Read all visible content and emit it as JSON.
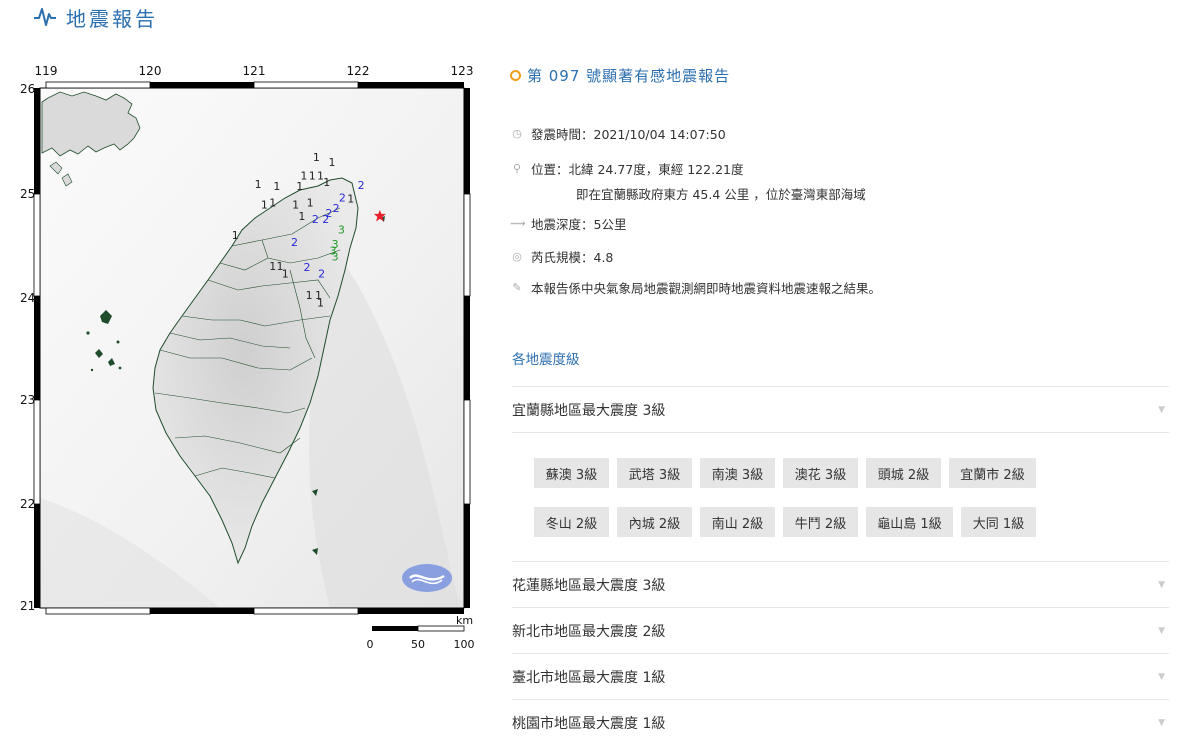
{
  "header": {
    "title": "地震報告",
    "icon": "seismograph-icon"
  },
  "map": {
    "lon_ticks": [
      "119",
      "120",
      "121",
      "122",
      "123"
    ],
    "lat_ticks": [
      "26",
      "25",
      "24",
      "23",
      "22",
      "21"
    ],
    "scale_unit": "km",
    "scale_labels": [
      "0",
      "50",
      "100"
    ],
    "epicenter": {
      "lon": 122.21,
      "lat": 24.77,
      "color": "#e8202a"
    },
    "intensity_colors": {
      "1": "#222222",
      "2": "#2a2ad8",
      "3": "#1f9a2a"
    },
    "intensity_marks": [
      {
        "v": "1",
        "lon": 121.6,
        "lat": 25.3
      },
      {
        "v": "1",
        "lon": 121.75,
        "lat": 25.25
      },
      {
        "v": "1",
        "lon": 121.48,
        "lat": 25.12
      },
      {
        "v": "1",
        "lon": 121.56,
        "lat": 25.12
      },
      {
        "v": "1",
        "lon": 121.64,
        "lat": 25.12
      },
      {
        "v": "1",
        "lon": 121.7,
        "lat": 25.06
      },
      {
        "v": "1",
        "lon": 121.04,
        "lat": 25.04
      },
      {
        "v": "1",
        "lon": 121.22,
        "lat": 25.02
      },
      {
        "v": "1",
        "lon": 121.44,
        "lat": 25.02
      },
      {
        "v": "1",
        "lon": 121.1,
        "lat": 24.84
      },
      {
        "v": "1",
        "lon": 121.18,
        "lat": 24.86
      },
      {
        "v": "1",
        "lon": 121.4,
        "lat": 24.84
      },
      {
        "v": "1",
        "lon": 121.54,
        "lat": 24.86
      },
      {
        "v": "1",
        "lon": 121.46,
        "lat": 24.73
      },
      {
        "v": "1",
        "lon": 121.93,
        "lat": 24.9
      },
      {
        "v": "1",
        "lon": 120.82,
        "lat": 24.55
      },
      {
        "v": "1",
        "lon": 121.18,
        "lat": 24.25
      },
      {
        "v": "1",
        "lon": 121.25,
        "lat": 24.25
      },
      {
        "v": "1",
        "lon": 121.3,
        "lat": 24.18
      },
      {
        "v": "1",
        "lon": 121.53,
        "lat": 23.97
      },
      {
        "v": "1",
        "lon": 121.62,
        "lat": 23.97
      },
      {
        "v": "1",
        "lon": 121.64,
        "lat": 23.9
      },
      {
        "v": "2",
        "lon": 122.03,
        "lat": 25.03
      },
      {
        "v": "2",
        "lon": 121.85,
        "lat": 24.91
      },
      {
        "v": "2",
        "lon": 121.79,
        "lat": 24.81
      },
      {
        "v": "2",
        "lon": 121.72,
        "lat": 24.76
      },
      {
        "v": "2",
        "lon": 121.59,
        "lat": 24.7
      },
      {
        "v": "2",
        "lon": 121.69,
        "lat": 24.7
      },
      {
        "v": "2",
        "lon": 121.39,
        "lat": 24.48
      },
      {
        "v": "2",
        "lon": 121.51,
        "lat": 24.24
      },
      {
        "v": "2",
        "lon": 121.65,
        "lat": 24.18
      },
      {
        "v": "3",
        "lon": 121.84,
        "lat": 24.6
      },
      {
        "v": "3",
        "lon": 121.78,
        "lat": 24.46
      },
      {
        "v": "3",
        "lon": 121.76,
        "lat": 24.4
      },
      {
        "v": "3",
        "lon": 121.78,
        "lat": 24.34
      }
    ],
    "logo": "cwb-logo"
  },
  "report": {
    "title": "第 097 號顯著有感地震報告",
    "time_label": "發震時間：2021/10/04 14:07:50",
    "location_label": "位置：北緯 24.77度，東經 122.21度",
    "location_detail": "即在宜蘭縣政府東方 45.4 公里 ，位於臺灣東部海域",
    "depth_label": "地震深度：5公里",
    "magnitude_label": "芮氏規模：4.8",
    "note": "本報告係中央氣象局地震觀測網即時地震資料地震速報之結果。",
    "icons": [
      "clock-icon",
      "pin-icon",
      "depth-icon",
      "magnitude-icon",
      "note-icon"
    ]
  },
  "intensity_section": {
    "heading": "各地震度級",
    "regions": [
      {
        "label": "宜蘭縣地區最大震度 3級",
        "expanded": true,
        "stations": [
          "蘇澳 3級",
          "武塔 3級",
          "南澳 3級",
          "澳花 3級",
          "頭城 2級",
          "宜蘭市 2級",
          "冬山 2級",
          "內城 2級",
          "南山 2級",
          "牛鬥 2級",
          "龜山島 1級",
          "大同 1級"
        ]
      },
      {
        "label": "花蓮縣地區最大震度 3級",
        "expanded": false
      },
      {
        "label": "新北市地區最大震度 2級",
        "expanded": false
      },
      {
        "label": "臺北市地區最大震度 1級",
        "expanded": false
      },
      {
        "label": "桃園市地區最大震度 1級",
        "expanded": false
      }
    ]
  }
}
